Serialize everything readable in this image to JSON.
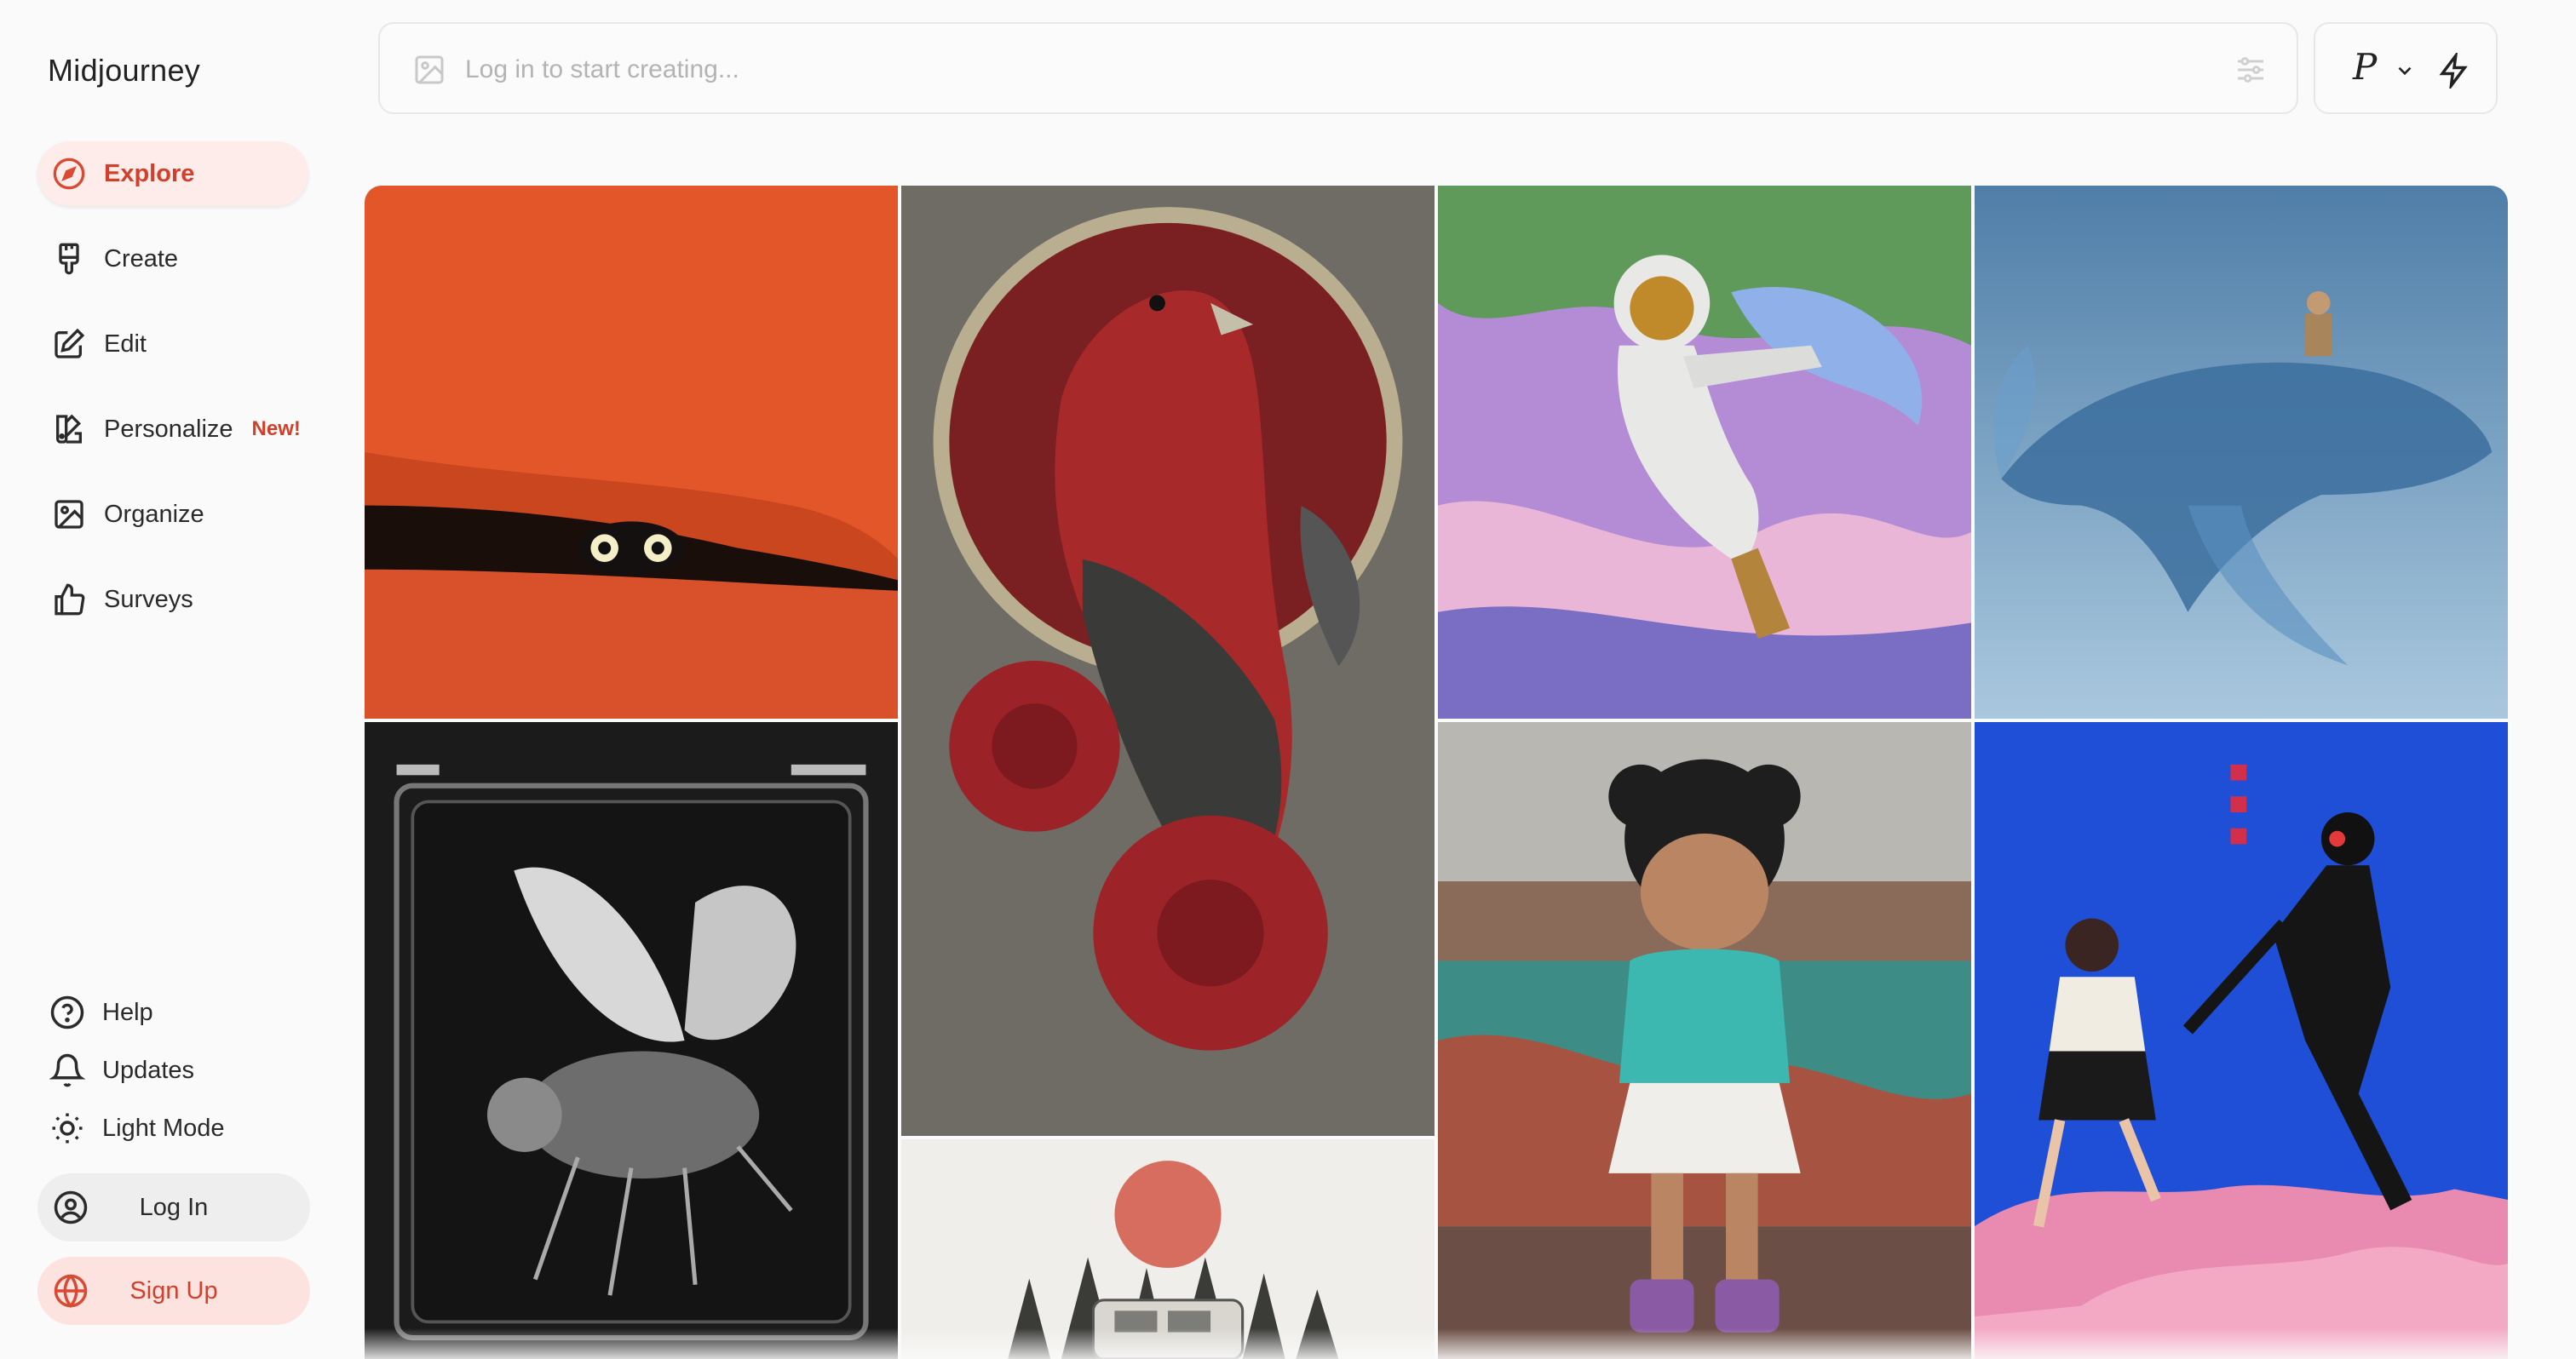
{
  "app": {
    "title": "Midjourney"
  },
  "sidebar": {
    "items": [
      {
        "label": "Explore",
        "icon": "compass-icon",
        "active": true
      },
      {
        "label": "Create",
        "icon": "paintbrush-icon"
      },
      {
        "label": "Edit",
        "icon": "edit-icon"
      },
      {
        "label": "Personalize",
        "icon": "palette-icon",
        "badge": "New!"
      },
      {
        "label": "Organize",
        "icon": "image-icon"
      },
      {
        "label": "Surveys",
        "icon": "thumbs-up-icon"
      }
    ],
    "bottom": [
      {
        "label": "Help",
        "icon": "help-icon"
      },
      {
        "label": "Updates",
        "icon": "bell-icon"
      },
      {
        "label": "Light Mode",
        "icon": "sun-icon"
      }
    ],
    "login_label": "Log In",
    "signup_label": "Sign Up"
  },
  "prompt": {
    "placeholder": "Log in to start creating...",
    "mode_label": "P"
  },
  "colors": {
    "accent": "#d23f2a",
    "accent_bg": "#fdecea",
    "background": "#fafafa"
  },
  "gallery": [
    {
      "name": "black-cat-orange-dunes-image"
    },
    {
      "name": "red-bird-peonies-image"
    },
    {
      "name": "astronaut-psychedelic-image"
    },
    {
      "name": "boy-riding-whale-image"
    },
    {
      "name": "xray-fly-film-image"
    },
    {
      "name": "lucy-character-graffiti-image"
    },
    {
      "name": "anime-girl-robot-sky-image"
    },
    {
      "name": "jeep-red-sun-forest-image"
    }
  ]
}
